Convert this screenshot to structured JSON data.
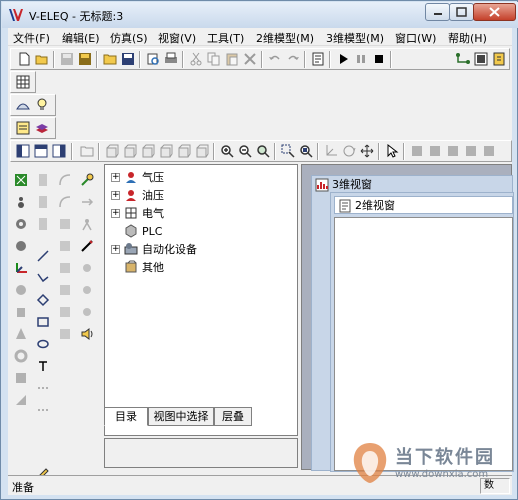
{
  "window": {
    "title": "V-ELEQ - 无标题:3"
  },
  "menu": [
    "文件(F)",
    "编辑(E)",
    "仿真(S)",
    "视窗(V)",
    "工具(T)",
    "2维模型(M)",
    "3维模型(M)",
    "窗口(W)",
    "帮助(H)"
  ],
  "tree": {
    "items": [
      {
        "label": "气压",
        "icon": "pneumatic-icon",
        "expandable": true
      },
      {
        "label": "油压",
        "icon": "hydraulic-icon",
        "expandable": true
      },
      {
        "label": "电气",
        "icon": "electric-icon",
        "expandable": true
      },
      {
        "label": "PLC",
        "icon": "plc-icon",
        "expandable": false
      },
      {
        "label": "自动化设备",
        "icon": "automation-device-icon",
        "expandable": true
      },
      {
        "label": "其他",
        "icon": "other-icon",
        "expandable": false
      }
    ]
  },
  "tabs": [
    "目录",
    "视图中选择",
    "层叠"
  ],
  "windows": {
    "view3d_title": "3维视窗",
    "view2d_title": "2维视窗"
  },
  "status": {
    "text": "准备",
    "right_cell": "数"
  },
  "watermark": {
    "brand": "当下软件园",
    "url": "www.downxia.com"
  },
  "colors": {
    "title_bar": "#d4e2f1",
    "mdi_background": "#aab0be",
    "child_frame": "#c8d6e8"
  }
}
